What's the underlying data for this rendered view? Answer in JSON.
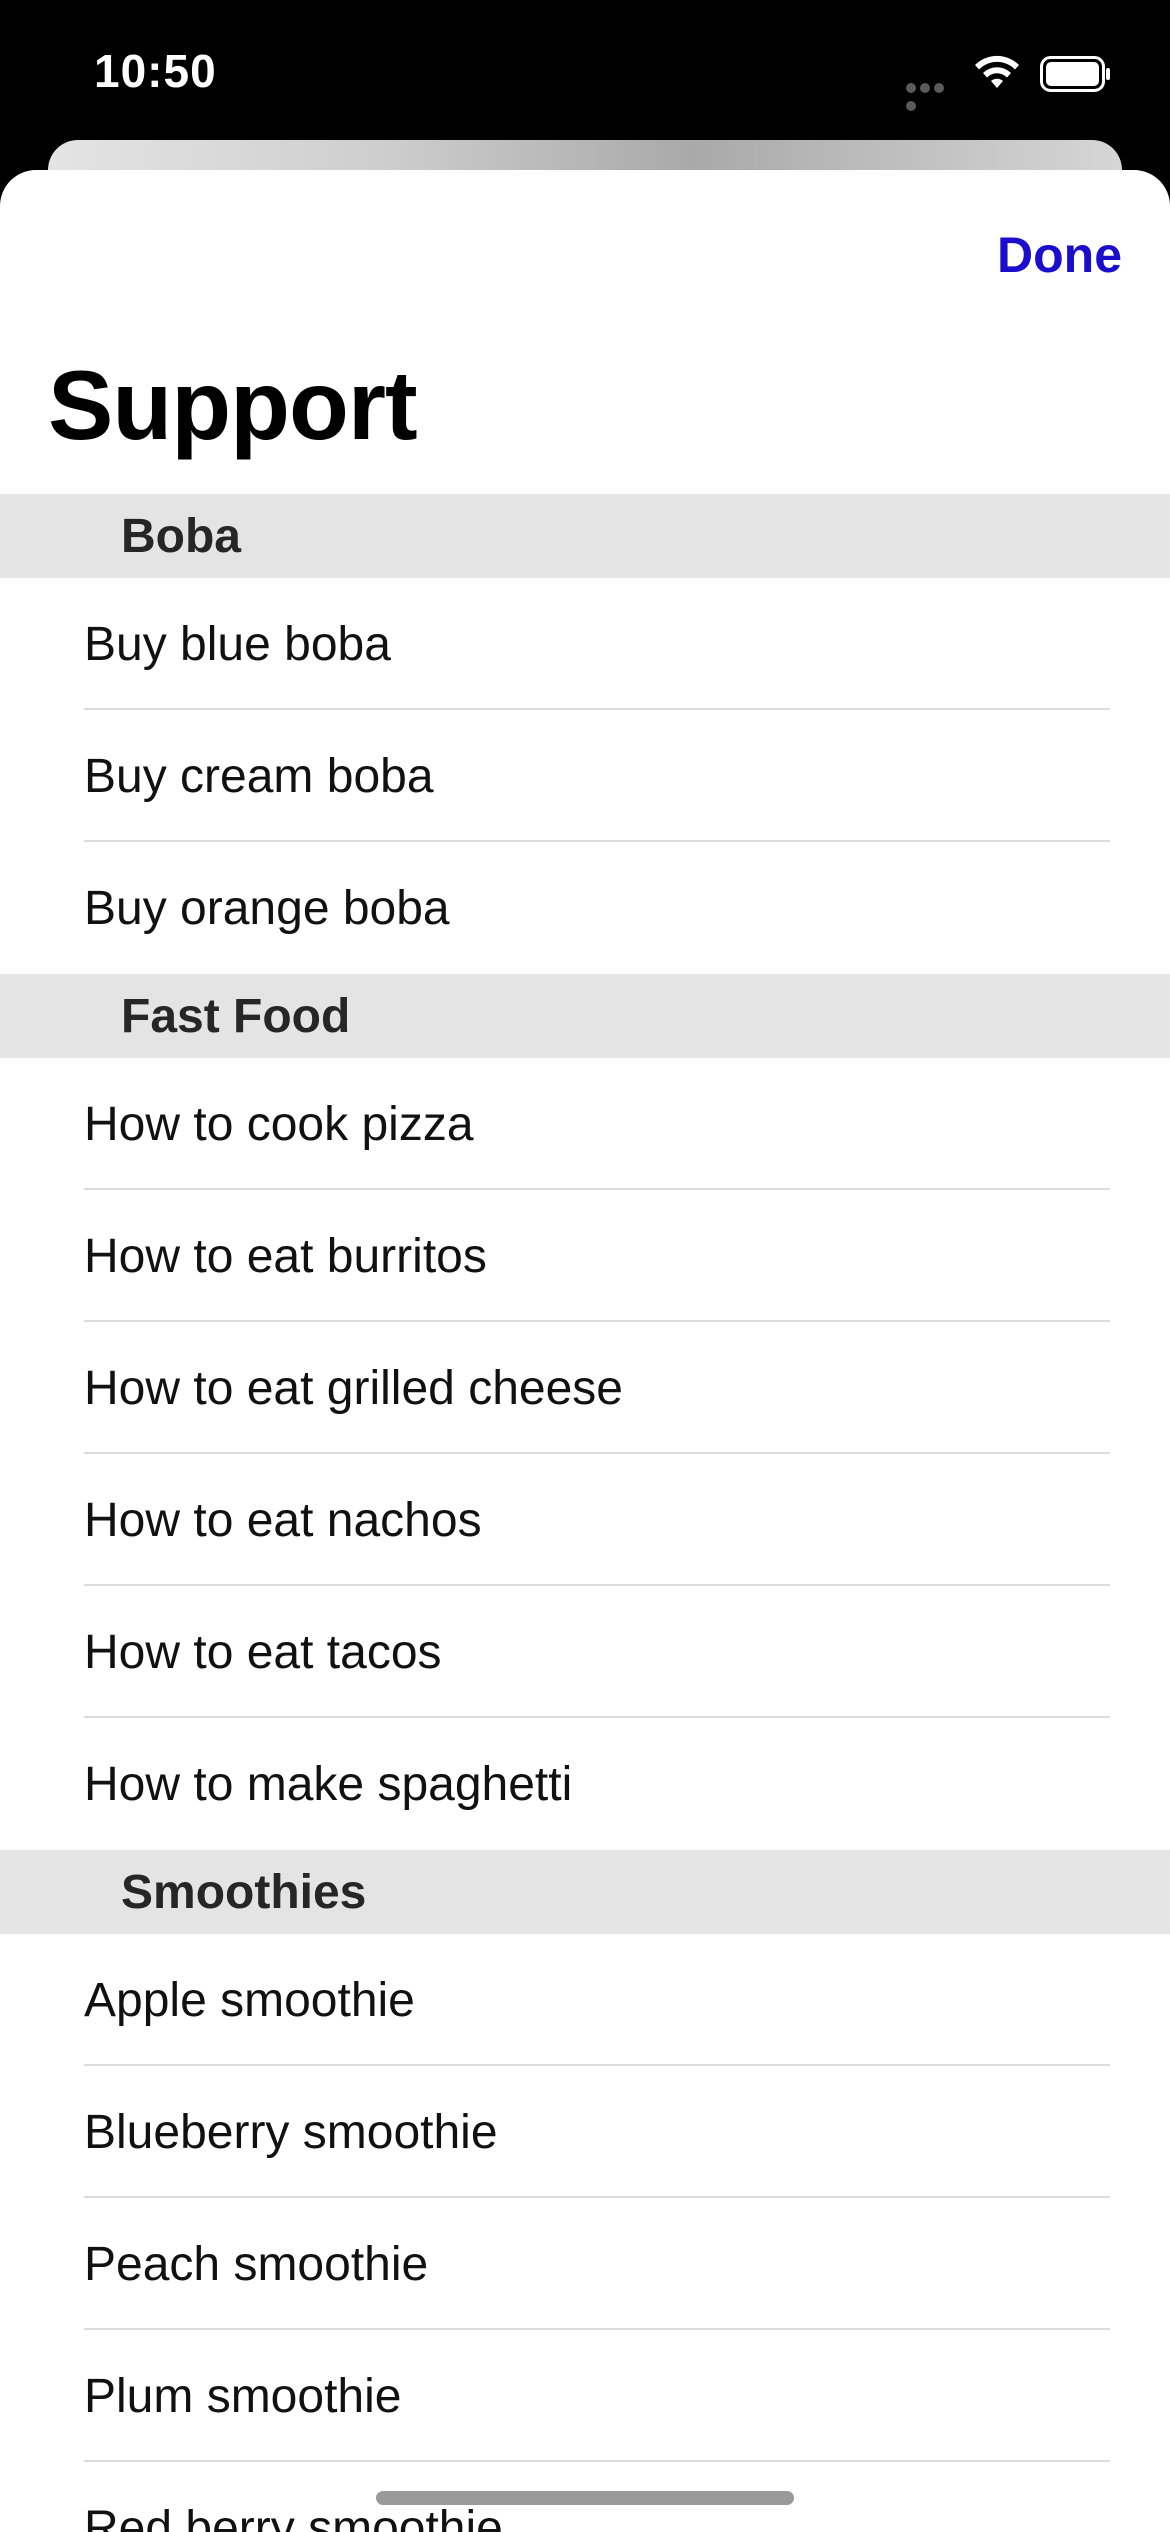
{
  "status_bar": {
    "time": "10:50"
  },
  "sheet": {
    "done_label": "Done",
    "title": "Support"
  },
  "colors": {
    "accent": "#1a0dcc",
    "section_bg": "#e4e4e4",
    "separator": "#dcdcdc"
  },
  "sections": [
    {
      "header": "Boba",
      "items": [
        "Buy blue boba",
        "Buy cream boba",
        "Buy orange boba"
      ]
    },
    {
      "header": "Fast Food",
      "items": [
        "How to cook pizza",
        "How to eat burritos",
        "How to eat grilled cheese",
        "How to eat nachos",
        "How to eat tacos",
        "How to make spaghetti"
      ]
    },
    {
      "header": "Smoothies",
      "items": [
        "Apple smoothie",
        "Blueberry smoothie",
        "Peach smoothie",
        "Plum smoothie",
        "Red berry smoothie"
      ]
    }
  ]
}
